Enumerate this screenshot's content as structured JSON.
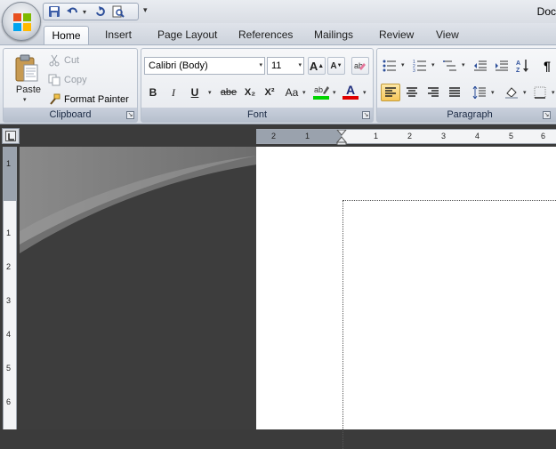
{
  "window": {
    "document_title": "Doc"
  },
  "quick_access": {
    "items": [
      {
        "name": "save-icon"
      },
      {
        "name": "undo-icon"
      },
      {
        "name": "repeat-icon"
      },
      {
        "name": "print-preview-icon"
      }
    ],
    "customize_glyph": "▾"
  },
  "tabs": [
    "Home",
    "Insert",
    "Page Layout",
    "References",
    "Mailings",
    "Review",
    "View"
  ],
  "active_tab": "Home",
  "ribbon": {
    "clipboard": {
      "label": "Clipboard",
      "paste": "Paste",
      "cut": "Cut",
      "copy": "Copy",
      "format_painter": "Format Painter"
    },
    "font": {
      "label": "Font",
      "font_name": "Calibri (Body)",
      "font_size": "11",
      "bold": "B",
      "italic": "I",
      "underline": "U",
      "strikethrough": "abe",
      "subscript": "X₂",
      "superscript": "X²",
      "change_case": "Aa",
      "grow": "A",
      "shrink": "A",
      "text_color": "A",
      "highlight_color": "#00d400",
      "font_color": "#e00000"
    },
    "paragraph": {
      "label": "Paragraph",
      "show_marks": "¶"
    }
  },
  "rulers": {
    "horizontal": [
      "2",
      "1",
      "1",
      "2",
      "3",
      "4",
      "5",
      "6"
    ],
    "vertical": [
      "1",
      "1",
      "2",
      "3",
      "4",
      "5",
      "6"
    ]
  },
  "colors": {
    "accent_active": "#f8c75a",
    "workspace": "#3d3d3d"
  }
}
